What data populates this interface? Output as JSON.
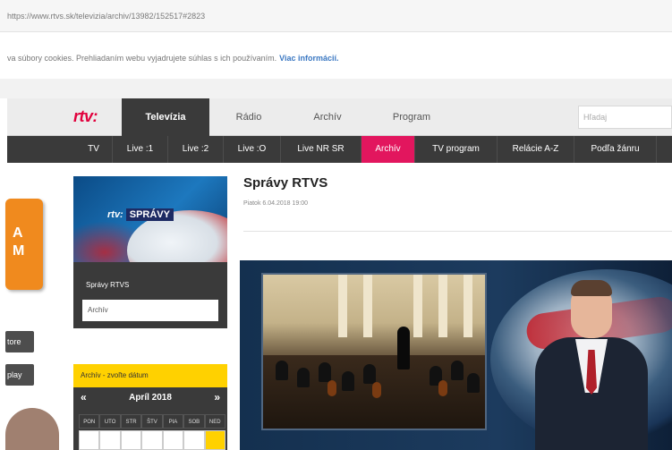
{
  "browser": {
    "url": "https://www.rtvs.sk/televizia/archiv/13982/152517#2823"
  },
  "cookie_bar": {
    "text": "va súbory cookies. Prehliadaním webu vyjadrujete súhlas s ich používaním.",
    "link": "Viac informácií."
  },
  "top_nav": {
    "logo": "rtv:",
    "tabs": [
      {
        "label": "Televízia",
        "active": true
      },
      {
        "label": "Rádio",
        "active": false
      },
      {
        "label": "Archív",
        "active": false
      },
      {
        "label": "Program",
        "active": false
      }
    ],
    "search_placeholder": "Hľadaj"
  },
  "sub_nav": {
    "items": [
      {
        "label": "TV",
        "active": false
      },
      {
        "label": "Live :1",
        "active": false
      },
      {
        "label": "Live :2",
        "active": false
      },
      {
        "label": "Live :O",
        "active": false
      },
      {
        "label": "Live NR SR",
        "active": false
      },
      {
        "label": "Archív",
        "active": true
      },
      {
        "label": "TV program",
        "active": false
      },
      {
        "label": "Relácie A-Z",
        "active": false
      },
      {
        "label": "Podľa žánru",
        "active": false
      }
    ]
  },
  "left_strip": {
    "tile_letters": [
      "A",
      "M"
    ],
    "buttons": [
      "tore",
      "play"
    ]
  },
  "show_card": {
    "logo_rtv": "rtv:",
    "logo_name": "SPRÁVY",
    "title": "Správy RTVS",
    "select_value": "Archív"
  },
  "archive": {
    "heading": "Archív - zvoľte dátum",
    "prev": "«",
    "next": "»",
    "month": "Apríl 2018",
    "weekdays": [
      "PON",
      "UTO",
      "STR",
      "ŠTV",
      "PIA",
      "SOB",
      "NED"
    ]
  },
  "article": {
    "title": "Správy RTVS",
    "date": "Piatok 6.04.2018 19:00"
  },
  "colors": {
    "brand_red": "#e1003c",
    "active_pink": "#e2165e",
    "archive_yellow": "#ffd100",
    "nav_dark": "#3a3a3a"
  }
}
